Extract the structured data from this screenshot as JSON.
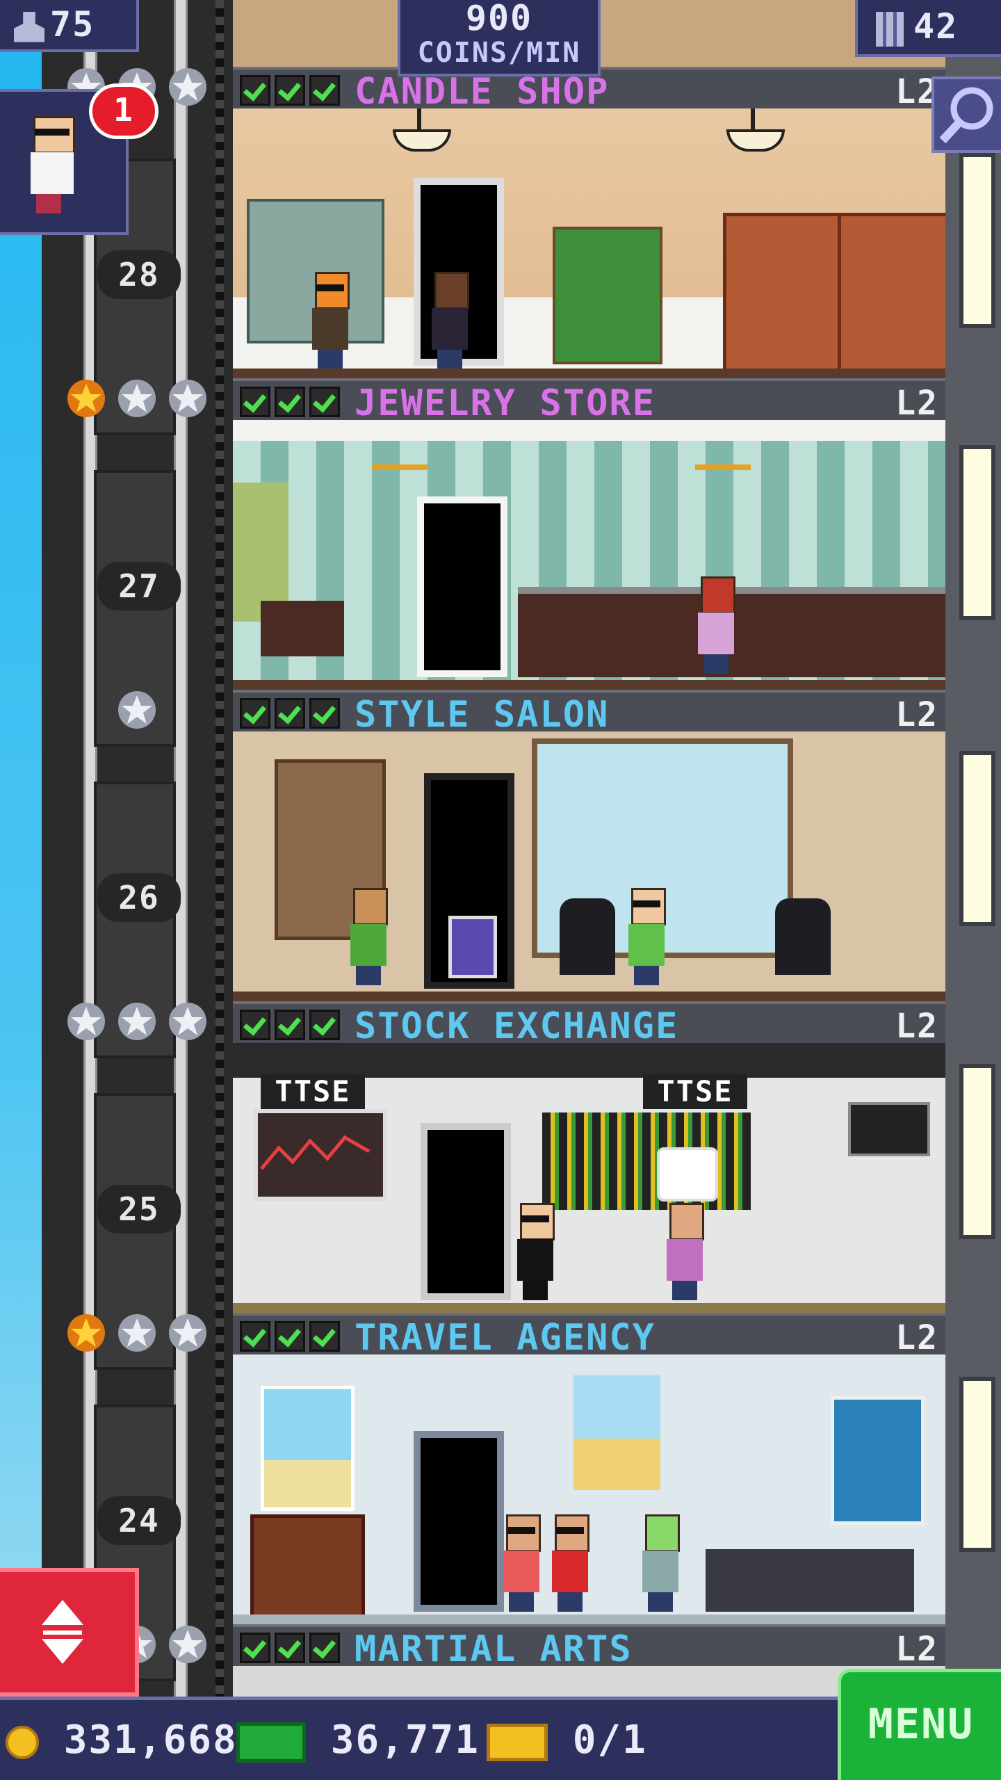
{
  "hud": {
    "population": "75",
    "coins_per_min_value": "900",
    "coins_per_min_label": "COINS/MIN",
    "floors_count": "42",
    "visitor_badge": "1"
  },
  "floors": [
    {
      "name": "CANDLE SHOP",
      "level": "L2",
      "number": "28",
      "color": "#d872e8"
    },
    {
      "name": "JEWELRY STORE",
      "level": "L2",
      "number": "27",
      "color": "#d872e8"
    },
    {
      "name": "STYLE SALON",
      "level": "L2",
      "number": "26",
      "color": "#5ec8f0"
    },
    {
      "name": "STOCK EXCHANGE",
      "level": "L2",
      "number": "25",
      "color": "#5ec8f0"
    },
    {
      "name": "TRAVEL AGENCY",
      "level": "L2",
      "number": "24",
      "color": "#5ec8f0"
    },
    {
      "name": "MARTIAL ARTS",
      "level": "L2",
      "number": "",
      "color": "#5ec8f0"
    }
  ],
  "signs": {
    "stock_left": "TTSE",
    "stock_right": "TTSE"
  },
  "bottom": {
    "coins": "331,668",
    "bux": "36,771",
    "tickets": "0/1",
    "menu_label": "MENU"
  },
  "icons": {
    "population": "person-icon",
    "floors": "building-icon",
    "search": "magnifier-icon",
    "coin": "coin-icon",
    "bux": "money-icon",
    "ticket": "ticket-icon",
    "elevator": "up-down-arrows-icon",
    "star_gold": "gold-star-icon",
    "star_silver": "silver-star-icon",
    "check": "green-check-icon"
  },
  "colors": {
    "hud_bg": "#2d2f5c",
    "menu_green": "#1bb23a",
    "elevator_red": "#e0263a",
    "badge_red": "#e51c2a"
  }
}
